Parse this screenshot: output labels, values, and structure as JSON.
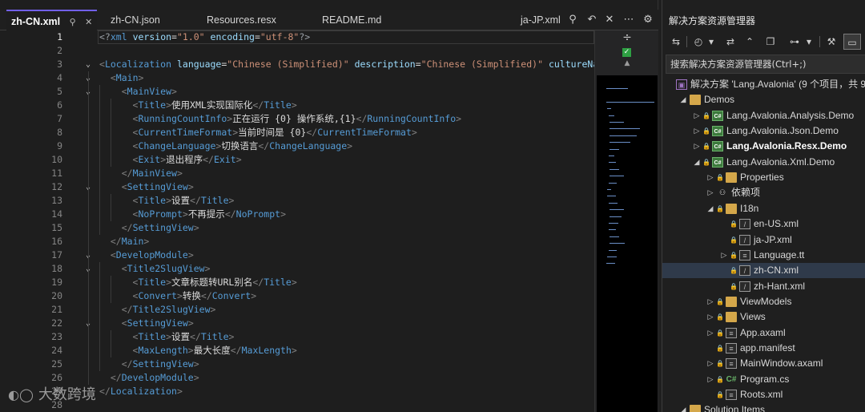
{
  "editor": {
    "tabs": [
      {
        "label": "zh-CN.xml",
        "active": true
      },
      {
        "label": "zh-CN.json"
      },
      {
        "label": "Resources.resx"
      },
      {
        "label": "README.md"
      },
      {
        "label": "ja-JP.xml"
      }
    ],
    "icons": {
      "pin": "pin-icon",
      "close": "close-icon",
      "back": "back-arrow-icon",
      "more": "more-icon",
      "settings": "gear-icon"
    },
    "lines": [
      {
        "n": "1",
        "html": "<span class=\"pi\">&lt;?</span><span class=\"tag\">xml</span> <span class=\"attr\">version</span>=<span class=\"val\">\"1.0\"</span> <span class=\"attr\">encoding</span>=<span class=\"val\">\"utf-8\"</span><span class=\"pi\">?&gt;</span>",
        "fold": "",
        "indent": 0,
        "current": true
      },
      {
        "n": "2",
        "html": "",
        "fold": "",
        "indent": 0
      },
      {
        "n": "3",
        "html": "<span class=\"br\">&lt;</span><span class=\"tag\">Localization</span> <span class=\"attr\">language</span>=<span class=\"val\">\"Chinese (Simplified)\"</span> <span class=\"attr\">description</span>=<span class=\"val\">\"Chinese (Simplified)\"</span> <span class=\"attr\">cultureNa</span>",
        "fold": "v",
        "indent": 0
      },
      {
        "n": "4",
        "html": "  <span class=\"br\">&lt;</span><span class=\"tag\">Main</span><span class=\"br\">&gt;</span>",
        "fold": "v",
        "indent": 1
      },
      {
        "n": "5",
        "html": "    <span class=\"br\">&lt;</span><span class=\"tag\">MainView</span><span class=\"br\">&gt;</span>",
        "fold": "v",
        "indent": 2
      },
      {
        "n": "6",
        "html": "      <span class=\"br\">&lt;</span><span class=\"tag\">Title</span><span class=\"br\">&gt;</span><span class=\"txt\">使用XML实现国际化</span><span class=\"br\">&lt;/</span><span class=\"tag\">Title</span><span class=\"br\">&gt;</span>",
        "fold": "",
        "indent": 3
      },
      {
        "n": "7",
        "html": "      <span class=\"br\">&lt;</span><span class=\"tag\">RunningCountInfo</span><span class=\"br\">&gt;</span><span class=\"txt\">正在运行 {0} 操作系统,{1}</span><span class=\"br\">&lt;/</span><span class=\"tag\">RunningCountInfo</span><span class=\"br\">&gt;</span>",
        "fold": "",
        "indent": 3
      },
      {
        "n": "8",
        "html": "      <span class=\"br\">&lt;</span><span class=\"tag\">CurrentTimeFormat</span><span class=\"br\">&gt;</span><span class=\"txt\">当前时间是 {0}</span><span class=\"br\">&lt;/</span><span class=\"tag\">CurrentTimeFormat</span><span class=\"br\">&gt;</span>",
        "fold": "",
        "indent": 3
      },
      {
        "n": "9",
        "html": "      <span class=\"br\">&lt;</span><span class=\"tag\">ChangeLanguage</span><span class=\"br\">&gt;</span><span class=\"txt\">切换语言</span><span class=\"br\">&lt;/</span><span class=\"tag\">ChangeLanguage</span><span class=\"br\">&gt;</span>",
        "fold": "",
        "indent": 3
      },
      {
        "n": "10",
        "html": "      <span class=\"br\">&lt;</span><span class=\"tag\">Exit</span><span class=\"br\">&gt;</span><span class=\"txt\">退出程序</span><span class=\"br\">&lt;/</span><span class=\"tag\">Exit</span><span class=\"br\">&gt;</span>",
        "fold": "",
        "indent": 3
      },
      {
        "n": "11",
        "html": "    <span class=\"br\">&lt;/</span><span class=\"tag\">MainView</span><span class=\"br\">&gt;</span>",
        "fold": "",
        "indent": 2
      },
      {
        "n": "12",
        "html": "    <span class=\"br\">&lt;</span><span class=\"tag\">SettingView</span><span class=\"br\">&gt;</span>",
        "fold": "v",
        "indent": 2
      },
      {
        "n": "13",
        "html": "      <span class=\"br\">&lt;</span><span class=\"tag\">Title</span><span class=\"br\">&gt;</span><span class=\"txt\">设置</span><span class=\"br\">&lt;/</span><span class=\"tag\">Title</span><span class=\"br\">&gt;</span>",
        "fold": "",
        "indent": 3
      },
      {
        "n": "14",
        "html": "      <span class=\"br\">&lt;</span><span class=\"tag\">NoPrompt</span><span class=\"br\">&gt;</span><span class=\"txt\">不再提示</span><span class=\"br\">&lt;/</span><span class=\"tag\">NoPrompt</span><span class=\"br\">&gt;</span>",
        "fold": "",
        "indent": 3
      },
      {
        "n": "15",
        "html": "    <span class=\"br\">&lt;/</span><span class=\"tag\">SettingView</span><span class=\"br\">&gt;</span>",
        "fold": "",
        "indent": 2
      },
      {
        "n": "16",
        "html": "  <span class=\"br\">&lt;/</span><span class=\"tag\">Main</span><span class=\"br\">&gt;</span>",
        "fold": "",
        "indent": 1
      },
      {
        "n": "17",
        "html": "  <span class=\"br\">&lt;</span><span class=\"tag\">DevelopModule</span><span class=\"br\">&gt;</span>",
        "fold": "v",
        "indent": 1
      },
      {
        "n": "18",
        "html": "    <span class=\"br\">&lt;</span><span class=\"tag\">Title2SlugView</span><span class=\"br\">&gt;</span>",
        "fold": "v",
        "indent": 2
      },
      {
        "n": "19",
        "html": "      <span class=\"br\">&lt;</span><span class=\"tag\">Title</span><span class=\"br\">&gt;</span><span class=\"txt\">文章标题转URL别名</span><span class=\"br\">&lt;/</span><span class=\"tag\">Title</span><span class=\"br\">&gt;</span>",
        "fold": "",
        "indent": 3
      },
      {
        "n": "20",
        "html": "      <span class=\"br\">&lt;</span><span class=\"tag\">Convert</span><span class=\"br\">&gt;</span><span class=\"txt\">转换</span><span class=\"br\">&lt;/</span><span class=\"tag\">Convert</span><span class=\"br\">&gt;</span>",
        "fold": "",
        "indent": 3
      },
      {
        "n": "21",
        "html": "    <span class=\"br\">&lt;/</span><span class=\"tag\">Title2SlugView</span><span class=\"br\">&gt;</span>",
        "fold": "",
        "indent": 2
      },
      {
        "n": "22",
        "html": "    <span class=\"br\">&lt;</span><span class=\"tag\">SettingView</span><span class=\"br\">&gt;</span>",
        "fold": "v",
        "indent": 2
      },
      {
        "n": "23",
        "html": "      <span class=\"br\">&lt;</span><span class=\"tag\">Title</span><span class=\"br\">&gt;</span><span class=\"txt\">设置</span><span class=\"br\">&lt;/</span><span class=\"tag\">Title</span><span class=\"br\">&gt;</span>",
        "fold": "",
        "indent": 3
      },
      {
        "n": "24",
        "html": "      <span class=\"br\">&lt;</span><span class=\"tag\">MaxLength</span><span class=\"br\">&gt;</span><span class=\"txt\">最大长度</span><span class=\"br\">&lt;/</span><span class=\"tag\">MaxLength</span><span class=\"br\">&gt;</span>",
        "fold": "",
        "indent": 3
      },
      {
        "n": "25",
        "html": "    <span class=\"br\">&lt;/</span><span class=\"tag\">SettingView</span><span class=\"br\">&gt;</span>",
        "fold": "",
        "indent": 2
      },
      {
        "n": "26",
        "html": "  <span class=\"br\">&lt;/</span><span class=\"tag\">DevelopModule</span><span class=\"br\">&gt;</span>",
        "fold": "",
        "indent": 1
      },
      {
        "n": "27",
        "html": "<span class=\"br\">&lt;/</span><span class=\"tag\">Localization</span><span class=\"br\">&gt;</span>",
        "fold": "",
        "indent": 0
      },
      {
        "n": "28",
        "html": "",
        "fold": "",
        "indent": 0
      }
    ]
  },
  "solution_explorer": {
    "title": "解决方案资源管理器",
    "search_placeholder": "搜索解决方案资源管理器(Ctrl+;)",
    "nodes": [
      {
        "label": "解决方案 'Lang.Avalonia' (9 个项目，共 9",
        "depth": 0,
        "icon": "sln",
        "exp": "",
        "lock": false
      },
      {
        "label": "Demos",
        "depth": 1,
        "icon": "folder",
        "exp": "◢",
        "lock": false
      },
      {
        "label": "Lang.Avalonia.Analysis.Demo",
        "depth": 2,
        "icon": "proj",
        "exp": "▷",
        "lock": true
      },
      {
        "label": "Lang.Avalonia.Json.Demo",
        "depth": 2,
        "icon": "proj",
        "exp": "▷",
        "lock": true
      },
      {
        "label": "Lang.Avalonia.Resx.Demo",
        "depth": 2,
        "icon": "proj",
        "exp": "▷",
        "lock": true,
        "bold": true
      },
      {
        "label": "Lang.Avalonia.Xml.Demo",
        "depth": 2,
        "icon": "proj",
        "exp": "◢",
        "lock": true
      },
      {
        "label": "Properties",
        "depth": 3,
        "icon": "folder",
        "exp": "▷",
        "lock": true
      },
      {
        "label": "依赖项",
        "depth": 3,
        "icon": "dep",
        "exp": "▷",
        "lock": false
      },
      {
        "label": "I18n",
        "depth": 3,
        "icon": "folder",
        "exp": "◢",
        "lock": true
      },
      {
        "label": "en-US.xml",
        "depth": 4,
        "icon": "xml",
        "exp": "",
        "lock": true
      },
      {
        "label": "ja-JP.xml",
        "depth": 4,
        "icon": "xml",
        "exp": "",
        "lock": true
      },
      {
        "label": "Language.tt",
        "depth": 4,
        "icon": "file",
        "exp": "▷",
        "lock": true
      },
      {
        "label": "zh-CN.xml",
        "depth": 4,
        "icon": "xml",
        "exp": "",
        "lock": true,
        "selected": true
      },
      {
        "label": "zh-Hant.xml",
        "depth": 4,
        "icon": "xml",
        "exp": "",
        "lock": true
      },
      {
        "label": "ViewModels",
        "depth": 3,
        "icon": "folder",
        "exp": "▷",
        "lock": true
      },
      {
        "label": "Views",
        "depth": 3,
        "icon": "folder",
        "exp": "▷",
        "lock": true
      },
      {
        "label": "App.axaml",
        "depth": 3,
        "icon": "file",
        "exp": "▷",
        "lock": true
      },
      {
        "label": "app.manifest",
        "depth": 3,
        "icon": "file",
        "exp": "",
        "lock": true
      },
      {
        "label": "MainWindow.axaml",
        "depth": 3,
        "icon": "file",
        "exp": "▷",
        "lock": true
      },
      {
        "label": "Program.cs",
        "depth": 3,
        "icon": "cs",
        "exp": "▷",
        "lock": true
      },
      {
        "label": "Roots.xml",
        "depth": 3,
        "icon": "file",
        "exp": "",
        "lock": true
      },
      {
        "label": "Solution Items",
        "depth": 1,
        "icon": "folder",
        "exp": "◢",
        "lock": false
      }
    ]
  },
  "watermark": {
    "text": "大数跨境",
    "logo": "logo-icon"
  },
  "colors": {
    "accent": "#7160e8",
    "tag": "#569cd6",
    "attr": "#9cdcfe",
    "value": "#ce9178"
  }
}
